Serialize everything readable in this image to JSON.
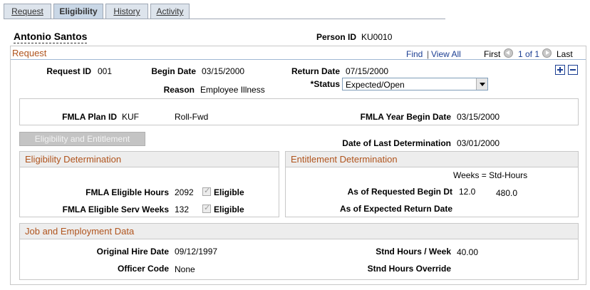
{
  "tabs": [
    {
      "label": "Request"
    },
    {
      "label": "Eligibility",
      "active": true
    },
    {
      "label": "History"
    },
    {
      "label": "Activity"
    }
  ],
  "employee": {
    "name": "Antonio Santos",
    "person_id_label": "Person ID",
    "person_id": "KU0010"
  },
  "request": {
    "title": "Request",
    "find": "Find",
    "view_all": "View All",
    "separator": "|",
    "first": "First",
    "range": "1 of 1",
    "last": "Last",
    "request_id_label": "Request ID",
    "request_id": "001",
    "begin_date_label": "Begin Date",
    "begin_date": "03/15/2000",
    "return_date_label": "Return Date",
    "return_date": "07/15/2000",
    "reason_label": "Reason",
    "reason": "Employee Illness",
    "status_label": "*Status",
    "status": "Expected/Open"
  },
  "plan": {
    "plan_id_label": "FMLA Plan ID",
    "plan_id": "KUF",
    "plan_desc": "Roll-Fwd",
    "year_begin_label": "FMLA Year Begin Date",
    "year_begin": "03/15/2000"
  },
  "eligibility_button": "Eligibility and Entitlement",
  "last_determination_label": "Date of Last Determination",
  "last_determination": "03/01/2000",
  "eligibility": {
    "title": "Eligibility Determination",
    "hours_label": "FMLA Eligible Hours",
    "hours": "2092",
    "hours_check": "Eligible",
    "weeks_label": "FMLA Eligible Serv Weeks",
    "weeks": "132",
    "weeks_check": "Eligible"
  },
  "entitlement": {
    "title": "Entitlement Determination",
    "header": "Weeks = Std-Hours",
    "req_begin_label": "As of Requested Begin Dt",
    "req_weeks": "12.0",
    "req_hours": "480.0",
    "exp_return_label": "As of Expected Return Date"
  },
  "job": {
    "title": "Job and Employment Data",
    "hire_label": "Original Hire Date",
    "hire": "09/12/1997",
    "officer_label": "Officer Code",
    "officer": "None",
    "std_hours_label": "Stnd Hours / Week",
    "std_hours": "40.00",
    "override_label": "Stnd Hours Override"
  }
}
